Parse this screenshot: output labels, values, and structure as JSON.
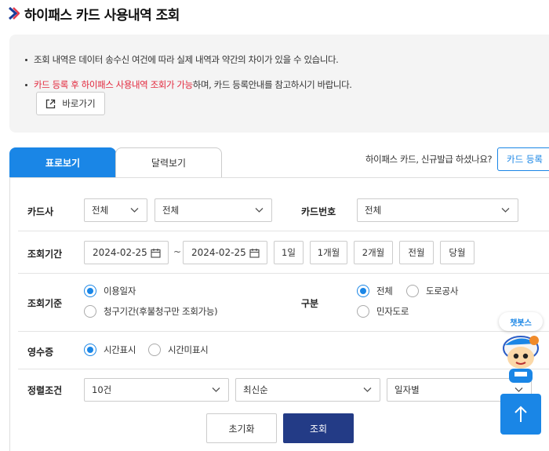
{
  "page": {
    "title": "하이패스 카드 사용내역 조회"
  },
  "notice": {
    "line1": "조회 내역은 데이터 송수신 여건에 따라 실제 내역과 약간의 차이가 있을 수 있습니다.",
    "line2_red": "카드 등록 후 하이패스 사용내역 조회가 가능",
    "line2_rest": "하며, 카드 등록안내를 참고하시기 바랍니다.",
    "go_label": "바로가기"
  },
  "tabs": [
    {
      "label": "표로보기",
      "active": true
    },
    {
      "label": "달력보기",
      "active": false
    }
  ],
  "register": {
    "question": "하이패스 카드, 신규발급 하셨나요?",
    "button": "카드 등록"
  },
  "form": {
    "card_company": {
      "label": "카드사",
      "select1": "전체",
      "select2": "전체"
    },
    "card_number": {
      "label": "카드번호",
      "value": "전체"
    },
    "period": {
      "label": "조회기간",
      "start": "2024-02-25",
      "tilde": "~",
      "end": "2024-02-25",
      "buttons": [
        "1일",
        "1개월",
        "2개월",
        "전월",
        "당월"
      ]
    },
    "basis": {
      "label": "조회기준",
      "options": [
        "이용일자",
        "청구기간(후불청구만 조회가능)"
      ],
      "selected": 0
    },
    "category": {
      "label": "구분",
      "options": [
        "전체",
        "도로공사",
        "민자도로"
      ],
      "selected": 0
    },
    "receipt": {
      "label": "영수증",
      "options": [
        "시간표시",
        "시간미표시"
      ],
      "selected": 0
    },
    "sort": {
      "label": "정렬조건",
      "count": "10건",
      "order": "최신순",
      "group": "일자별"
    }
  },
  "actions": {
    "reset": "초기화",
    "search": "조회"
  },
  "chatbot": {
    "label": "챗봇스"
  },
  "colors": {
    "accent": "#1a86e6",
    "navy": "#233b86",
    "red": "#e2273c"
  }
}
